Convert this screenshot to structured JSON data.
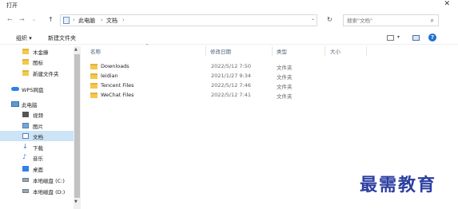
{
  "window": {
    "title": "打开",
    "close_glyph": "✕"
  },
  "nav": {
    "back": "←",
    "forward": "→",
    "recent": "⌄",
    "up": "↑",
    "refresh": "↻"
  },
  "breadcrumb": {
    "items": [
      "此电脑",
      "文档"
    ],
    "separator": "›",
    "dropdown": "⌄"
  },
  "search": {
    "placeholder": "搜索\"文档\"",
    "icon": "search-icon"
  },
  "toolbar": {
    "organize": "组织 ▾",
    "new_folder": "新建文件夹",
    "view_dropdown": "▾",
    "help": "?"
  },
  "sidebar": {
    "items": [
      {
        "label": "木金藤",
        "icon": "folder-icon"
      },
      {
        "label": "图标",
        "icon": "folder-icon"
      },
      {
        "label": "新建文件夹",
        "icon": "folder-icon"
      },
      {
        "label": "WPS网盘",
        "icon": "cloud-icon"
      },
      {
        "label": "此电脑",
        "icon": "computer-icon"
      },
      {
        "label": "视频",
        "icon": "video-icon"
      },
      {
        "label": "图片",
        "icon": "pictures-icon"
      },
      {
        "label": "文档",
        "icon": "documents-icon",
        "selected": true
      },
      {
        "label": "下载",
        "icon": "download-icon"
      },
      {
        "label": "音乐",
        "icon": "music-icon"
      },
      {
        "label": "桌面",
        "icon": "desktop-icon"
      },
      {
        "label": "本地磁盘 (C:)",
        "icon": "drive-icon"
      },
      {
        "label": "本地磁盘 (D:)",
        "icon": "drive-icon"
      }
    ]
  },
  "columns": {
    "name": "名称",
    "date": "修改日期",
    "type": "类型",
    "size": "大小"
  },
  "files": [
    {
      "name": "Downloads",
      "date": "2022/5/12 7:50",
      "type": "文件夹"
    },
    {
      "name": "leidian",
      "date": "2021/1/27 9:34",
      "type": "文件夹"
    },
    {
      "name": "Tencent Files",
      "date": "2022/5/12 7:46",
      "type": "文件夹"
    },
    {
      "name": "WeChat Files",
      "date": "2022/5/12 7:41",
      "type": "文件夹"
    }
  ],
  "watermark": "最需教育"
}
